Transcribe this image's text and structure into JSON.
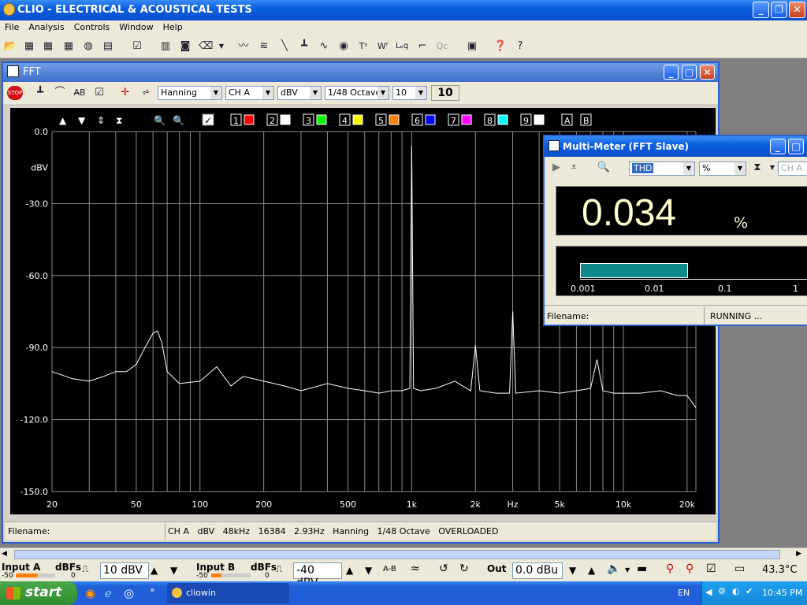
{
  "app": {
    "title": "CLIO - ELECTRICAL & ACOUSTICAL TESTS"
  },
  "menu": [
    "File",
    "Analysis",
    "Controls",
    "Window",
    "Help"
  ],
  "fft": {
    "title": "FFT",
    "window_select": "Hanning",
    "channel_select": "CH A",
    "unit_select": "dBV",
    "smoothing_select": "1/48 Octave",
    "avg_select": "10",
    "avg_count": "10",
    "channel_buttons": [
      "1",
      "2",
      "3",
      "4",
      "5",
      "6",
      "7",
      "8",
      "9",
      "A",
      "B"
    ],
    "channel_colors": [
      "#ff0000",
      "#ffffff",
      "#00ff00",
      "#ffff00",
      "#ff8000",
      "#0000ff",
      "#ff00ff",
      "#00ffff",
      "#ffffff"
    ],
    "filename_label": "Filename:",
    "status_text": "CH A   dBV   48kHz   16384   2.93Hz   Hanning   1/48 Octave   OVERLOADED"
  },
  "chart_data": {
    "type": "line",
    "ylabel": "dBV",
    "xlabel": "Hz",
    "x_scale": "log",
    "xlim": [
      20,
      22000
    ],
    "ylim": [
      -150,
      0
    ],
    "y_ticks": [
      "0.0",
      "-30.0",
      "-60.0",
      "-90.0",
      "-120.0",
      "-150.0"
    ],
    "x_ticks": [
      "20",
      "50",
      "100",
      "200",
      "500",
      "1k",
      "2k",
      "5k",
      "10k",
      "20k"
    ],
    "grid": true,
    "series": [
      {
        "color": "#ffffff",
        "x": [
          20,
          25,
          30,
          35,
          40,
          45,
          50,
          55,
          60,
          63,
          66,
          70,
          80,
          100,
          120,
          140,
          160,
          200,
          250,
          300,
          400,
          500,
          600,
          700,
          800,
          900,
          980,
          1000,
          1020,
          1100,
          1300,
          1600,
          1900,
          2000,
          2100,
          2500,
          2900,
          3000,
          3100,
          4000,
          5000,
          6000,
          7000,
          7500,
          8000,
          9000,
          10000,
          12000,
          15000,
          18000,
          20000,
          22000
        ],
        "y": [
          -100,
          -103,
          -104,
          -102,
          -100,
          -100,
          -97,
          -90,
          -84,
          -83,
          -88,
          -100,
          -105,
          -104,
          -98,
          -106,
          -102,
          -104,
          -106,
          -108,
          -105,
          -107,
          -108,
          -109,
          -108,
          -108,
          -107,
          -6,
          -107,
          -108,
          -107,
          -104,
          -108,
          -89,
          -108,
          -109,
          -109,
          -75,
          -109,
          -108,
          -109,
          -108,
          -107,
          -95,
          -108,
          -109,
          -109,
          -109,
          -108,
          -110,
          -110,
          -115
        ]
      }
    ]
  },
  "multimeter": {
    "title": "Multi-Meter (FFT Slave)",
    "measure_select": "THD",
    "unit_select": "%",
    "channel_select": "CH A",
    "value": "0.034",
    "unit": "%",
    "bar_level": 0.57,
    "bar_ticks": [
      "0.001",
      "0.01",
      "0.1",
      "1"
    ],
    "filename_label": "Filename:",
    "status": "RUNNING ..."
  },
  "bottom": {
    "input_a": "Input A",
    "input_a_dbfs": "dBFs",
    "input_a_scale_min": "-50",
    "input_a_scale_max": "0",
    "input_a_level": "10 dBV",
    "input_b": "Input B",
    "input_b_dbfs": "dBFs",
    "input_b_scale_min": "-50",
    "input_b_scale_max": "0",
    "input_b_level": "-40 dBV",
    "out_label": "Out",
    "out_level": "0.0 dBu",
    "temperature": "43.3°C"
  },
  "taskbar": {
    "start": "start",
    "task": "cliowin",
    "lang": "EN",
    "time": "10:45 PM"
  }
}
